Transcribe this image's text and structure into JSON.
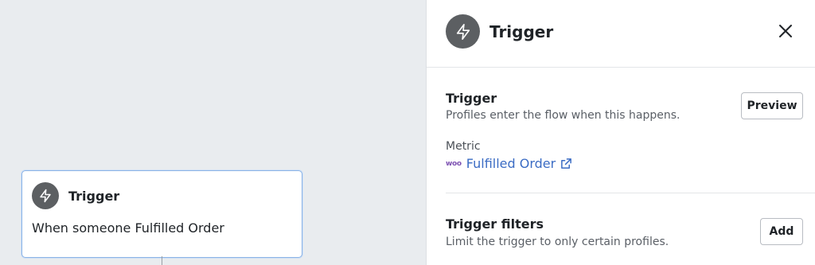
{
  "canvas": {
    "node": {
      "title": "Trigger",
      "description": "When someone Fulfilled Order",
      "icon": "lightning-bolt-icon"
    }
  },
  "panel": {
    "header": {
      "title": "Trigger",
      "icon": "lightning-bolt-icon",
      "close_icon": "close-icon"
    },
    "trigger_section": {
      "title": "Trigger",
      "subtitle": "Profiles enter the flow when this happens.",
      "button_label": "Preview",
      "metric_label": "Metric",
      "metric_logo": "woo",
      "metric_value": "Fulfilled Order",
      "metric_link_icon": "external-link-icon"
    },
    "filters_section": {
      "title": "Trigger filters",
      "subtitle": "Limit the trigger to only certain profiles.",
      "button_label": "Add"
    }
  },
  "colors": {
    "canvas_bg": "#e9ecef",
    "icon_circle": "#5c5f62",
    "link": "#3b6cc4",
    "node_border": "#8cb4e6",
    "woo_brand": "#7f54b3"
  }
}
